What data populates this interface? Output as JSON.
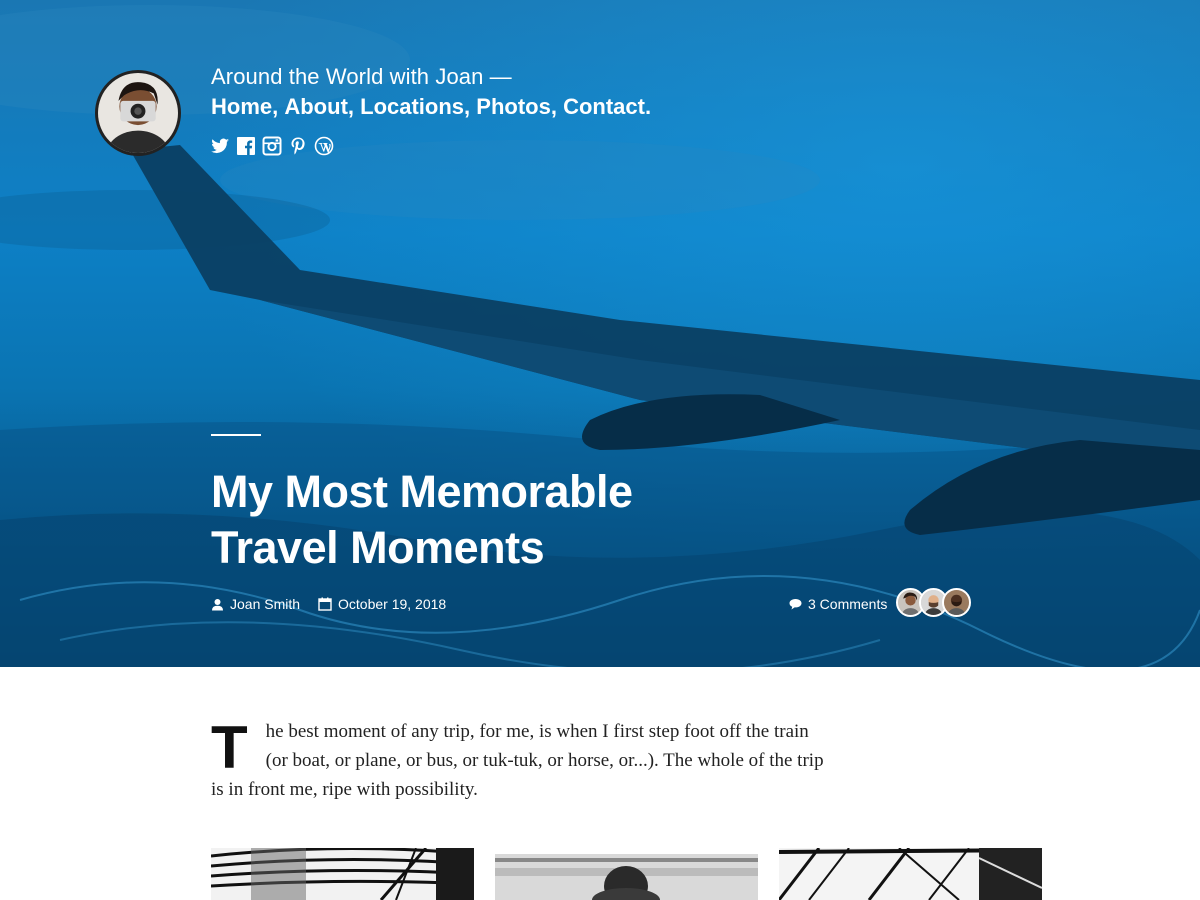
{
  "site": {
    "title": "Around the World with Joan —",
    "nav": [
      {
        "label": "Home",
        "sep": ", "
      },
      {
        "label": "About",
        "sep": ", "
      },
      {
        "label": "Locations",
        "sep": ", "
      },
      {
        "label": "Photos",
        "sep": ", "
      },
      {
        "label": "Contact",
        "sep": "."
      }
    ],
    "social_icons": [
      "twitter-icon",
      "facebook-icon",
      "instagram-icon",
      "pinterest-icon",
      "wordpress-icon"
    ]
  },
  "post": {
    "title": "My Most Memorable Travel Moments",
    "author": "Joan Smith",
    "date": "October 19, 2018",
    "comments": "3 Comments",
    "commenter_count": 3,
    "dropcap": "T",
    "intro": "he best moment of any trip, for me, is when I first step foot off the train (or boat, or plane, or bus, or tuk-tuk, or horse, or...). The whole of the trip is in front me, ripe with possibility."
  },
  "colors": {
    "hero_blue": "#0d80c6",
    "hero_dark": "#063f66",
    "text_white": "#ffffff",
    "body_text": "#222222"
  },
  "gallery": [
    "gallery-image-architecture",
    "gallery-image-person",
    "gallery-image-structure"
  ]
}
